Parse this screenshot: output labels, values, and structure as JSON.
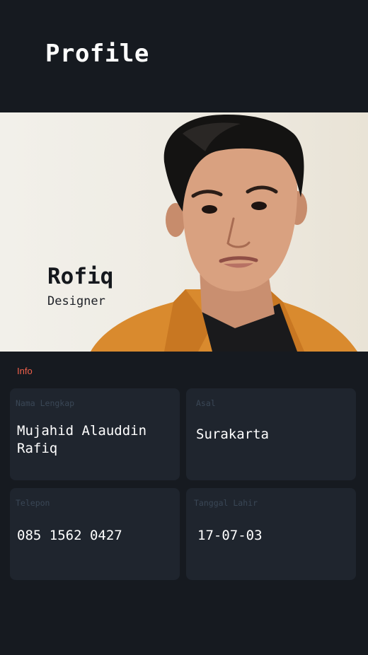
{
  "header": {
    "title": "Profile"
  },
  "profile": {
    "name": "Rofiq",
    "role": "Designer"
  },
  "info": {
    "section_label": "Info",
    "fields": [
      {
        "label": "Nama Lengkap",
        "value": "Mujahid Alauddin Rafiq"
      },
      {
        "label": "Asal",
        "value": "Surakarta"
      },
      {
        "label": "Telepon",
        "value": "085 1562 0427"
      },
      {
        "label": "Tanggal Lahir",
        "value": "17-07-03"
      }
    ]
  },
  "colors": {
    "background": "#161a20",
    "card": "#1f252e",
    "accent": "#f0604a",
    "card_label": "#3a4756",
    "text": "#ffffff"
  }
}
